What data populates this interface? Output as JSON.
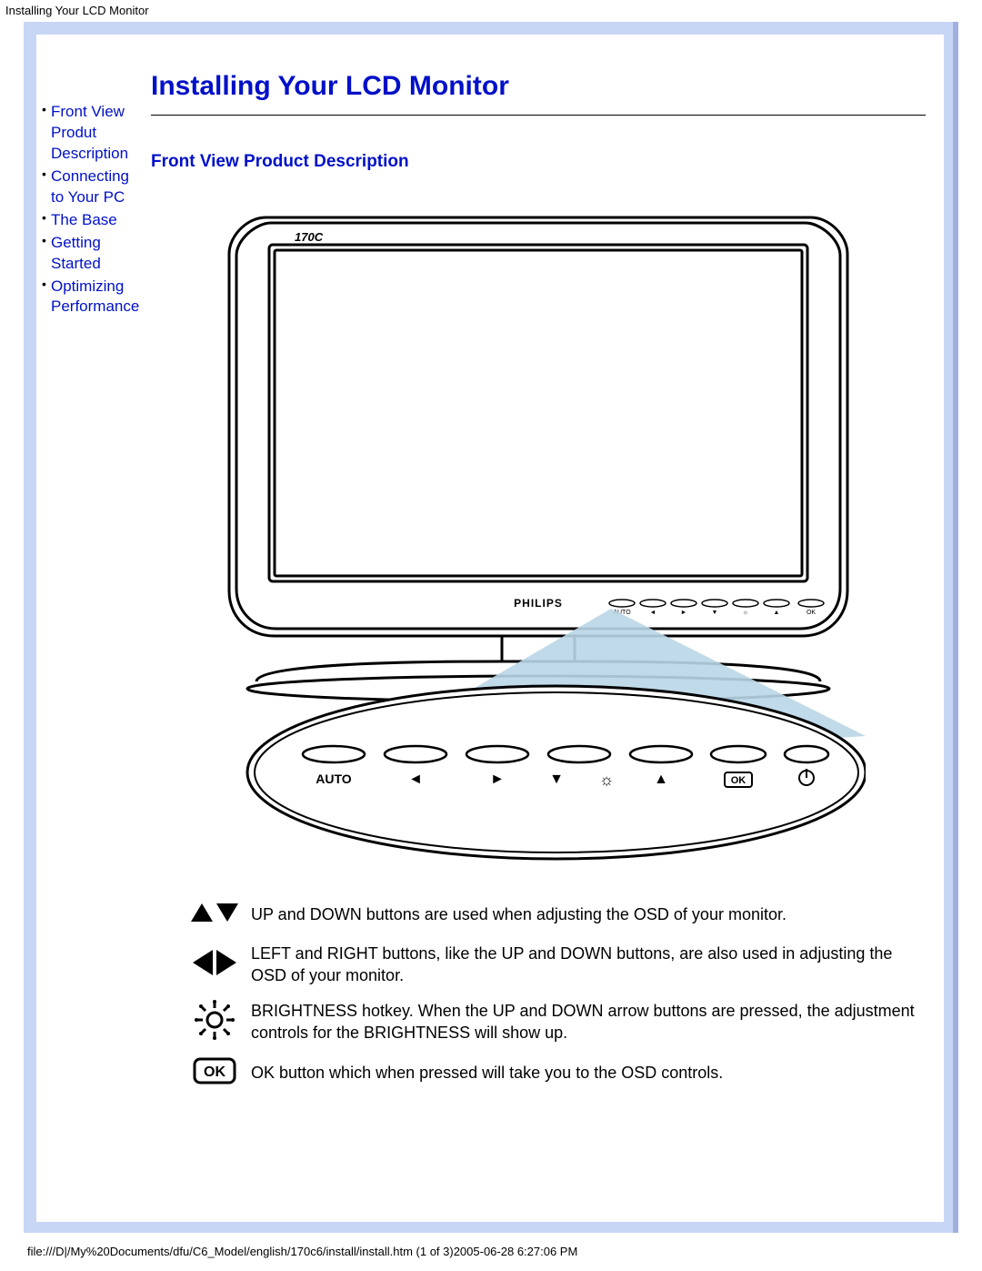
{
  "header": {
    "title": "Installing Your LCD Monitor"
  },
  "sidebar": {
    "items": [
      {
        "label": "Front View Produt Description"
      },
      {
        "label": "Connecting to Your PC"
      },
      {
        "label": "The Base"
      },
      {
        "label": "Getting Started"
      },
      {
        "label": "Optimizing Performance"
      }
    ]
  },
  "content": {
    "page_title": "Installing Your LCD Monitor",
    "section_title": "Front View Product Description"
  },
  "diagram": {
    "bezel_label": "170C",
    "brand": "PHILIPS",
    "panel_buttons": [
      "AUTO",
      "◄",
      "►",
      "▼",
      "☼",
      "▲",
      "OK",
      "⏻"
    ]
  },
  "legend": [
    {
      "icon": "up-down-arrows",
      "text": "UP and DOWN buttons are used when adjusting the OSD of your monitor."
    },
    {
      "icon": "left-right-arrows",
      "text": "LEFT and RIGHT buttons, like the UP and DOWN buttons, are also used in adjusting the OSD of your monitor."
    },
    {
      "icon": "brightness-icon",
      "text": "BRIGHTNESS hotkey. When the UP and DOWN arrow buttons are pressed, the adjustment controls for the BRIGHTNESS will show up."
    },
    {
      "icon": "ok-icon",
      "text": "OK button which when pressed will take you to the OSD controls."
    }
  ],
  "footer": {
    "text": "file:///D|/My%20Documents/dfu/C6_Model/english/170c6/install/install.htm (1 of 3)2005-06-28 6:27:06 PM"
  }
}
